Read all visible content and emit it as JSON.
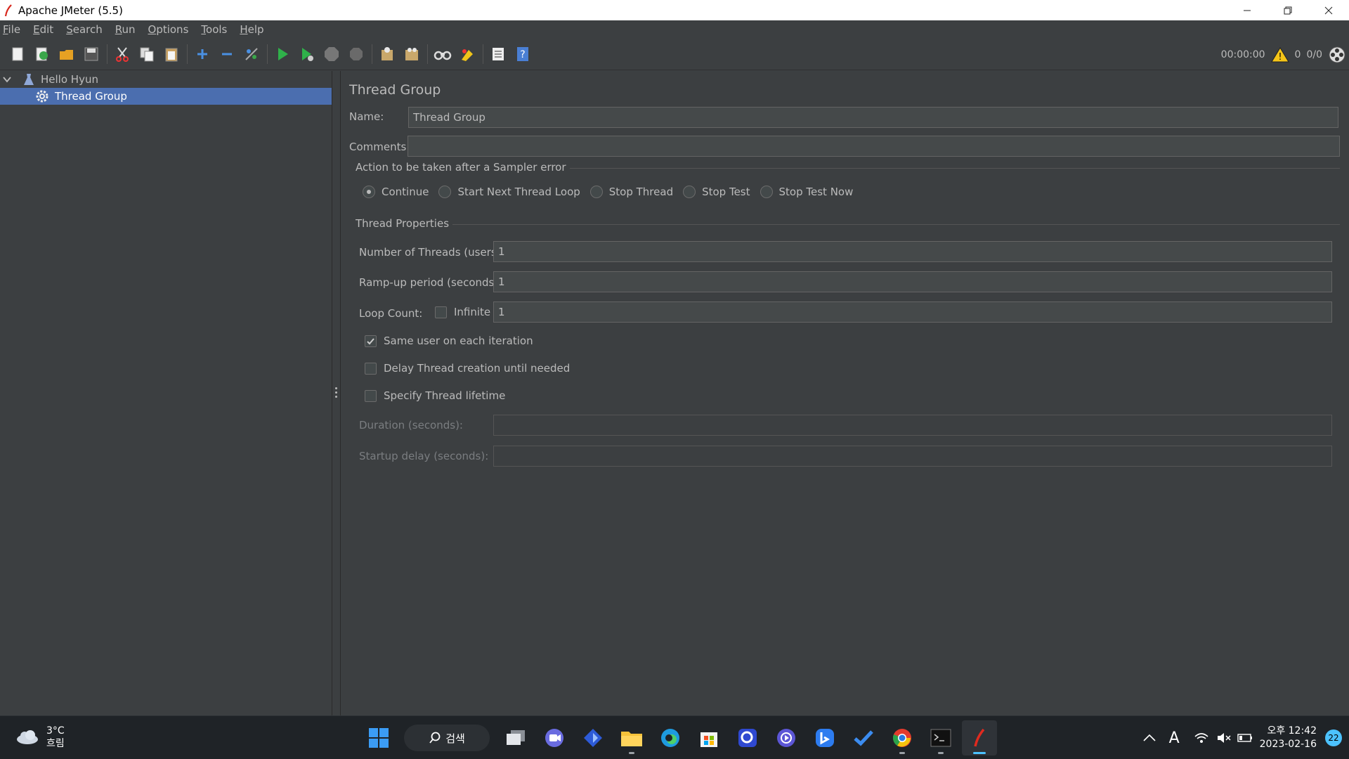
{
  "window": {
    "title": "Apache JMeter (5.5)",
    "controls": [
      "minimize-icon",
      "restore-icon",
      "close-icon"
    ]
  },
  "menu": [
    {
      "label": "File",
      "mnemonic": "F",
      "rest": "ile"
    },
    {
      "label": "Edit",
      "mnemonic": "E",
      "rest": "dit"
    },
    {
      "label": "Search",
      "mnemonic": "S",
      "rest": "earch"
    },
    {
      "label": "Run",
      "mnemonic": "R",
      "rest": "un"
    },
    {
      "label": "Options",
      "mnemonic": "O",
      "rest": "ptions"
    },
    {
      "label": "Tools",
      "mnemonic": "T",
      "rest": "ools"
    },
    {
      "label": "Help",
      "mnemonic": "H",
      "rest": "elp"
    }
  ],
  "toolbar": {
    "icons": [
      "new-icon",
      "templates-icon",
      "open-icon",
      "save-icon",
      "cut-icon",
      "copy-icon",
      "paste-icon",
      "expand-icon",
      "collapse-icon",
      "toggle-icon",
      "start-icon",
      "start-no-pauses-icon",
      "stop-icon",
      "shutdown-icon",
      "clear-icon",
      "clear-all-icon",
      "search-icon",
      "reset-search-icon",
      "function-helper-icon",
      "help-icon"
    ],
    "timer": "00:00:00",
    "warnings": "0",
    "threads": "0/0"
  },
  "tree": {
    "root": "Hello Hyun",
    "child": "Thread Group"
  },
  "panel": {
    "title": "Thread Group",
    "name_label": "Name:",
    "name_value": "Thread Group",
    "comments_label": "Comments:",
    "comments_value": "",
    "sampler_error_title": "Action to be taken after a Sampler error",
    "sampler_actions": [
      {
        "label": "Continue",
        "selected": true
      },
      {
        "label": "Start Next Thread Loop",
        "selected": false
      },
      {
        "label": "Stop Thread",
        "selected": false
      },
      {
        "label": "Stop Test",
        "selected": false
      },
      {
        "label": "Stop Test Now",
        "selected": false
      }
    ],
    "thread_props_title": "Thread Properties",
    "threads_label": "Number of Threads (users):",
    "threads_value": "1",
    "rampup_label": "Ramp-up period (seconds):",
    "rampup_value": "1",
    "loop_label": "Loop Count:",
    "infinite_label": "Infinite",
    "infinite_checked": false,
    "loop_value": "1",
    "same_user_label": "Same user on each iteration",
    "same_user_checked": true,
    "delay_label": "Delay Thread creation until needed",
    "delay_checked": false,
    "lifetime_label": "Specify Thread lifetime",
    "lifetime_checked": false,
    "duration_label": "Duration (seconds):",
    "duration_value": "",
    "startup_label": "Startup delay (seconds):",
    "startup_value": ""
  },
  "taskbar": {
    "weather_temp": "3°C",
    "weather_desc": "흐림",
    "search_label": "검색",
    "clock_time": "오후 12:42",
    "clock_date": "2023-02-16",
    "notification_count": "22",
    "ime_label": "A"
  }
}
